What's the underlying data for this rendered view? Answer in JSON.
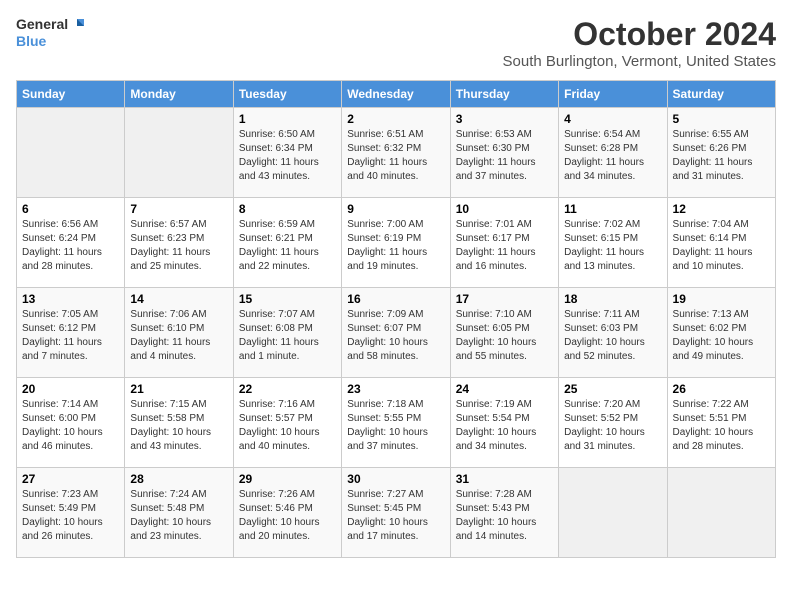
{
  "logo": {
    "general": "General",
    "blue": "Blue"
  },
  "title": "October 2024",
  "subtitle": "South Burlington, Vermont, United States",
  "days_header": [
    "Sunday",
    "Monday",
    "Tuesday",
    "Wednesday",
    "Thursday",
    "Friday",
    "Saturday"
  ],
  "weeks": [
    [
      {
        "day": "",
        "info": ""
      },
      {
        "day": "",
        "info": ""
      },
      {
        "day": "1",
        "info": "Sunrise: 6:50 AM\nSunset: 6:34 PM\nDaylight: 11 hours and 43 minutes."
      },
      {
        "day": "2",
        "info": "Sunrise: 6:51 AM\nSunset: 6:32 PM\nDaylight: 11 hours and 40 minutes."
      },
      {
        "day": "3",
        "info": "Sunrise: 6:53 AM\nSunset: 6:30 PM\nDaylight: 11 hours and 37 minutes."
      },
      {
        "day": "4",
        "info": "Sunrise: 6:54 AM\nSunset: 6:28 PM\nDaylight: 11 hours and 34 minutes."
      },
      {
        "day": "5",
        "info": "Sunrise: 6:55 AM\nSunset: 6:26 PM\nDaylight: 11 hours and 31 minutes."
      }
    ],
    [
      {
        "day": "6",
        "info": "Sunrise: 6:56 AM\nSunset: 6:24 PM\nDaylight: 11 hours and 28 minutes."
      },
      {
        "day": "7",
        "info": "Sunrise: 6:57 AM\nSunset: 6:23 PM\nDaylight: 11 hours and 25 minutes."
      },
      {
        "day": "8",
        "info": "Sunrise: 6:59 AM\nSunset: 6:21 PM\nDaylight: 11 hours and 22 minutes."
      },
      {
        "day": "9",
        "info": "Sunrise: 7:00 AM\nSunset: 6:19 PM\nDaylight: 11 hours and 19 minutes."
      },
      {
        "day": "10",
        "info": "Sunrise: 7:01 AM\nSunset: 6:17 PM\nDaylight: 11 hours and 16 minutes."
      },
      {
        "day": "11",
        "info": "Sunrise: 7:02 AM\nSunset: 6:15 PM\nDaylight: 11 hours and 13 minutes."
      },
      {
        "day": "12",
        "info": "Sunrise: 7:04 AM\nSunset: 6:14 PM\nDaylight: 11 hours and 10 minutes."
      }
    ],
    [
      {
        "day": "13",
        "info": "Sunrise: 7:05 AM\nSunset: 6:12 PM\nDaylight: 11 hours and 7 minutes."
      },
      {
        "day": "14",
        "info": "Sunrise: 7:06 AM\nSunset: 6:10 PM\nDaylight: 11 hours and 4 minutes."
      },
      {
        "day": "15",
        "info": "Sunrise: 7:07 AM\nSunset: 6:08 PM\nDaylight: 11 hours and 1 minute."
      },
      {
        "day": "16",
        "info": "Sunrise: 7:09 AM\nSunset: 6:07 PM\nDaylight: 10 hours and 58 minutes."
      },
      {
        "day": "17",
        "info": "Sunrise: 7:10 AM\nSunset: 6:05 PM\nDaylight: 10 hours and 55 minutes."
      },
      {
        "day": "18",
        "info": "Sunrise: 7:11 AM\nSunset: 6:03 PM\nDaylight: 10 hours and 52 minutes."
      },
      {
        "day": "19",
        "info": "Sunrise: 7:13 AM\nSunset: 6:02 PM\nDaylight: 10 hours and 49 minutes."
      }
    ],
    [
      {
        "day": "20",
        "info": "Sunrise: 7:14 AM\nSunset: 6:00 PM\nDaylight: 10 hours and 46 minutes."
      },
      {
        "day": "21",
        "info": "Sunrise: 7:15 AM\nSunset: 5:58 PM\nDaylight: 10 hours and 43 minutes."
      },
      {
        "day": "22",
        "info": "Sunrise: 7:16 AM\nSunset: 5:57 PM\nDaylight: 10 hours and 40 minutes."
      },
      {
        "day": "23",
        "info": "Sunrise: 7:18 AM\nSunset: 5:55 PM\nDaylight: 10 hours and 37 minutes."
      },
      {
        "day": "24",
        "info": "Sunrise: 7:19 AM\nSunset: 5:54 PM\nDaylight: 10 hours and 34 minutes."
      },
      {
        "day": "25",
        "info": "Sunrise: 7:20 AM\nSunset: 5:52 PM\nDaylight: 10 hours and 31 minutes."
      },
      {
        "day": "26",
        "info": "Sunrise: 7:22 AM\nSunset: 5:51 PM\nDaylight: 10 hours and 28 minutes."
      }
    ],
    [
      {
        "day": "27",
        "info": "Sunrise: 7:23 AM\nSunset: 5:49 PM\nDaylight: 10 hours and 26 minutes."
      },
      {
        "day": "28",
        "info": "Sunrise: 7:24 AM\nSunset: 5:48 PM\nDaylight: 10 hours and 23 minutes."
      },
      {
        "day": "29",
        "info": "Sunrise: 7:26 AM\nSunset: 5:46 PM\nDaylight: 10 hours and 20 minutes."
      },
      {
        "day": "30",
        "info": "Sunrise: 7:27 AM\nSunset: 5:45 PM\nDaylight: 10 hours and 17 minutes."
      },
      {
        "day": "31",
        "info": "Sunrise: 7:28 AM\nSunset: 5:43 PM\nDaylight: 10 hours and 14 minutes."
      },
      {
        "day": "",
        "info": ""
      },
      {
        "day": "",
        "info": ""
      }
    ]
  ]
}
